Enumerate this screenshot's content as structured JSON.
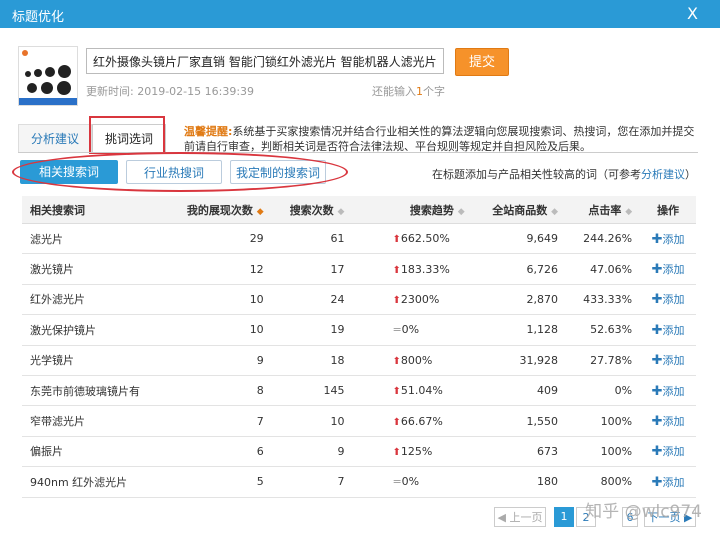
{
  "window": {
    "title": "标题优化",
    "close_label": "X"
  },
  "product": {
    "title_value": "红外摄像头镜片厂家直销 智能门锁红外滤光片 智能机器人滤光片",
    "submit_label": "提交",
    "updated_text": "更新时间: 2019-02-15 16:39:39",
    "remain_prefix": "还能输入",
    "remain_count": "1",
    "remain_suffix": "个字"
  },
  "tabs": [
    {
      "label": "分析建议"
    },
    {
      "label": "挑词选词"
    }
  ],
  "notice": {
    "prefix": "温馨提醒:",
    "text": "系统基于买家搜索情况并结合行业相关性的算法逻辑向您展现搜索词、热搜词，您在添加并提交前请自行审查，判断相关词是否符合法律法规、平台规则等规定并自担风险及后果。"
  },
  "subtabs": [
    {
      "label": "相关搜索词"
    },
    {
      "label": "行业热搜词"
    },
    {
      "label": "我定制的搜索词"
    }
  ],
  "hint": {
    "text": "在标题添加与产品相关性较高的词（可参考",
    "link": "分析建议",
    "suffix": "）"
  },
  "table": {
    "headers": {
      "keyword": "相关搜索词",
      "impressions": "我的展现次数",
      "searches": "搜索次数",
      "trend": "搜索趋势",
      "products": "全站商品数",
      "ctr": "点击率",
      "action": "操作"
    },
    "add_label": "添加",
    "rows": [
      {
        "keyword": "滤光片",
        "impressions": "29",
        "searches": "61",
        "trend": "662.50%",
        "trend_dir": "up",
        "products": "9,649",
        "ctr": "244.26%"
      },
      {
        "keyword": "激光镜片",
        "impressions": "12",
        "searches": "17",
        "trend": "183.33%",
        "trend_dir": "up",
        "products": "6,726",
        "ctr": "47.06%"
      },
      {
        "keyword": "红外滤光片",
        "impressions": "10",
        "searches": "24",
        "trend": "2300%",
        "trend_dir": "up",
        "products": "2,870",
        "ctr": "433.33%"
      },
      {
        "keyword": "激光保护镜片",
        "impressions": "10",
        "searches": "19",
        "trend": "0%",
        "trend_dir": "flat",
        "products": "1,128",
        "ctr": "52.63%"
      },
      {
        "keyword": "光学镜片",
        "impressions": "9",
        "searches": "18",
        "trend": "800%",
        "trend_dir": "up",
        "products": "31,928",
        "ctr": "27.78%"
      },
      {
        "keyword": "东莞市前德玻璃镜片有",
        "impressions": "8",
        "searches": "145",
        "trend": "51.04%",
        "trend_dir": "up",
        "products": "409",
        "ctr": "0%"
      },
      {
        "keyword": "窄带滤光片",
        "impressions": "7",
        "searches": "10",
        "trend": "66.67%",
        "trend_dir": "up",
        "products": "1,550",
        "ctr": "100%"
      },
      {
        "keyword": "偏振片",
        "impressions": "6",
        "searches": "9",
        "trend": "125%",
        "trend_dir": "up",
        "products": "673",
        "ctr": "100%"
      },
      {
        "keyword": "940nm 红外滤光片",
        "impressions": "5",
        "searches": "7",
        "trend": "0%",
        "trend_dir": "flat",
        "products": "180",
        "ctr": "800%"
      }
    ]
  },
  "pager": {
    "prev": "上一页",
    "p1": "1",
    "p2": "2",
    "p6": "6",
    "next": "下一页"
  },
  "watermark": "知乎 @wlc974",
  "colors": {
    "accent": "#2a9ad6",
    "orange": "#f6922a",
    "red_highlight": "#d9363e"
  }
}
